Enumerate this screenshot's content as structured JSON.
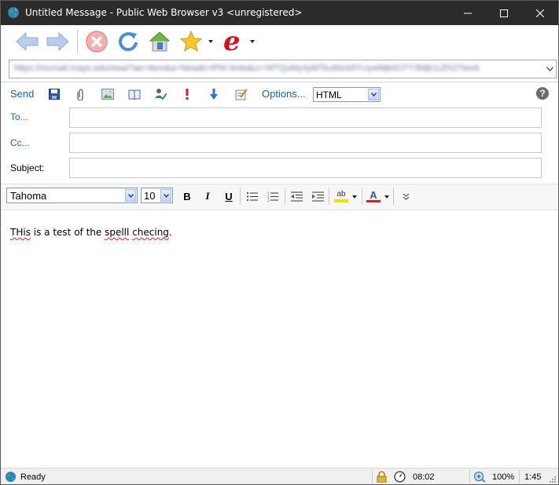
{
  "window": {
    "title": "Untitled Message - Public Web Browser v3 <unregistered>",
    "icon": "globe-icon",
    "controls": [
      "minimize-icon",
      "maximize-icon",
      "close-icon"
    ]
  },
  "browser_toolbar": {
    "buttons": [
      "back-arrow-icon",
      "forward-arrow-icon",
      "stop-icon",
      "refresh-icon",
      "home-icon",
      "favorites-star-icon",
      "browser-e-logo-icon"
    ]
  },
  "address_bar": {
    "url": "https://mcmail.mayo.edu/owa/?ae=Item&a=New&t=IPM.Note&cc=MTQuMy4yMTkuMzIsIlYUywMjk0OTY3Mjk1LEh2Tiwvb"
  },
  "mail_toolbar": {
    "send": "Send",
    "options": "Options...",
    "format": "HTML",
    "icons": [
      "save-icon",
      "attach-paperclip-icon",
      "insert-image-icon",
      "address-book-icon",
      "check-names-icon",
      "high-importance-icon",
      "low-importance-icon",
      "signature-icon"
    ]
  },
  "header": {
    "to_label": "To...",
    "cc_label": "Cc...",
    "subject_label": "Subject:",
    "to_value": "",
    "cc_value": "",
    "subject_value": ""
  },
  "format_toolbar": {
    "font": "Tahoma",
    "size": "10",
    "bold": "B",
    "italic": "I",
    "underline": "U",
    "highlight_glyph": "ab",
    "font_color_glyph": "A",
    "highlight_color": "#f2e000",
    "font_color": "#e0191b"
  },
  "message_body": {
    "w1": "THis",
    "w2": " is a test of the ",
    "w3": "spelll",
    "w4": " ",
    "w5": "checing",
    "w6": "."
  },
  "status_bar": {
    "status": "Ready",
    "clock_value": "08:02",
    "zoom": "100%",
    "time": "1:45"
  }
}
